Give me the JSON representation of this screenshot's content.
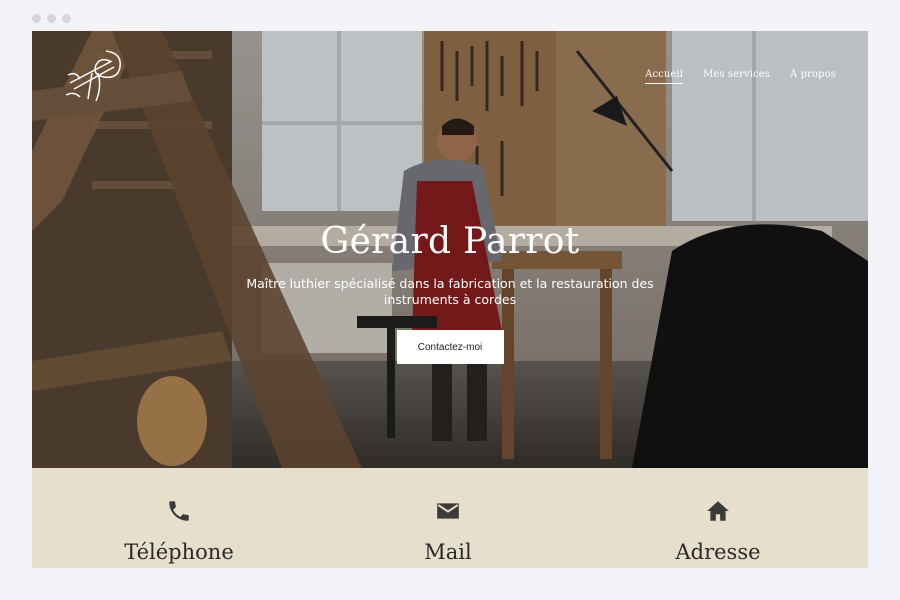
{
  "nav": {
    "items": [
      {
        "label": "Accueil",
        "active": true
      },
      {
        "label": "Mes services",
        "active": false
      },
      {
        "label": "À propos",
        "active": false
      }
    ]
  },
  "hero": {
    "title": "Gérard Parrot",
    "subtitle": "Maître luthier spécialisé dans la fabrication et la restauration des instruments à cordes",
    "cta_label": "Contactez-moi"
  },
  "contact": {
    "items": [
      {
        "label": "Téléphone",
        "icon": "phone-icon"
      },
      {
        "label": "Mail",
        "icon": "mail-icon"
      },
      {
        "label": "Adresse",
        "icon": "home-icon"
      }
    ]
  },
  "colors": {
    "contact_background": "#e6dfcb",
    "icon": "#3a3a3a",
    "hero_text": "#ffffff"
  }
}
